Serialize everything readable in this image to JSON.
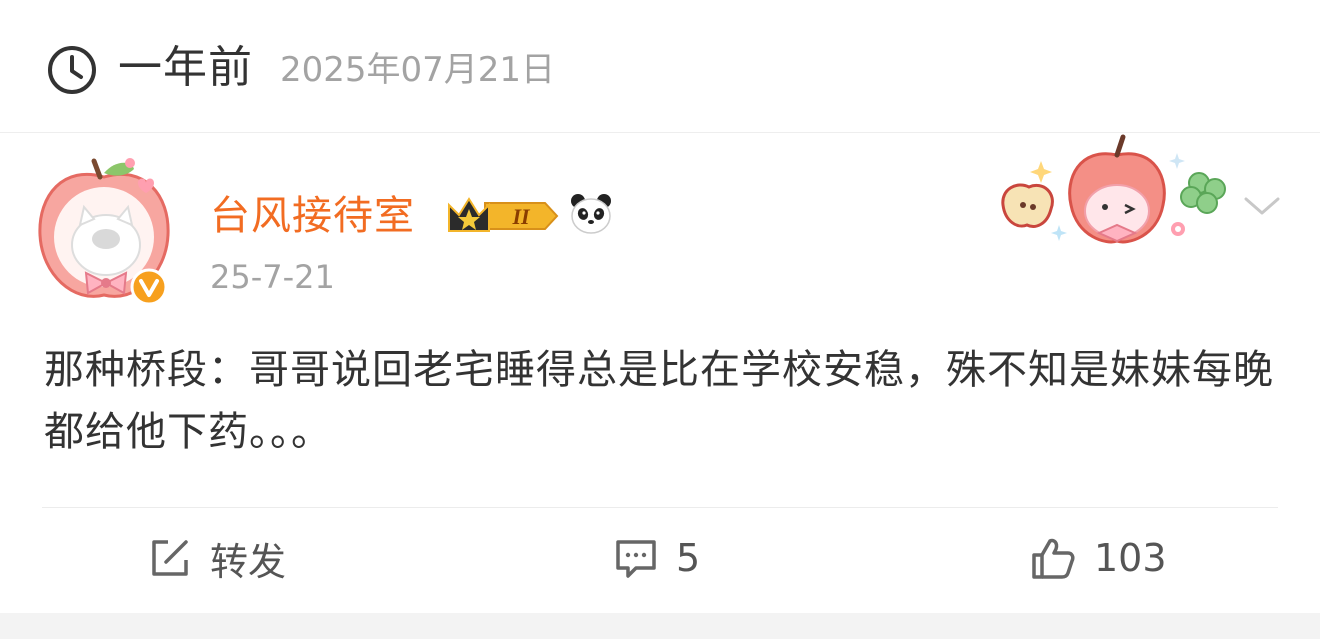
{
  "memory": {
    "relative_time": "一年前",
    "date": "2025年07月21日"
  },
  "post": {
    "username": "台风接待室",
    "username_color": "#f26c22",
    "level_badge": "II",
    "time": "25-7-21",
    "text": "那种桥段：哥哥说回老宅睡得总是比在学校安稳，殊不知是妹妹每晚都给他下药。。。",
    "icons": {
      "verified": "verified-v-icon",
      "crown": "crown-level-badge-icon",
      "panda": "panda-icon",
      "more": "chevron-down-icon"
    }
  },
  "actions": {
    "repost_label": "转发",
    "comment_count": "5",
    "like_count": "103"
  }
}
